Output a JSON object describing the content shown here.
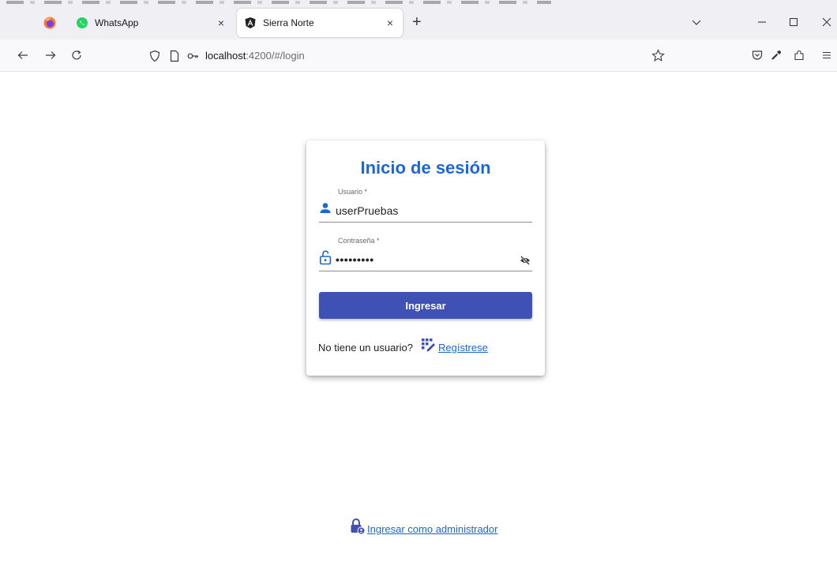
{
  "browser": {
    "tabs": [
      {
        "label": "WhatsApp",
        "close": "×"
      },
      {
        "label": "Sierra Norte",
        "close": "×"
      }
    ],
    "new_tab": "+",
    "url_host": "localhost",
    "url_path": ":4200/#/login"
  },
  "login": {
    "title": "Inicio de sesión",
    "username_label": "Usuario *",
    "username_value": "userPruebas",
    "password_label": "Contraseña *",
    "password_value": "•••••••••",
    "submit_label": "Ingresar",
    "register_prompt": "No tiene un usuario?",
    "register_link": "Regístrese",
    "admin_link": "Ingresar como administrador"
  },
  "colors": {
    "primary_button": "#3f51b5",
    "title": "#1e66d3",
    "link": "#1e66d3"
  }
}
